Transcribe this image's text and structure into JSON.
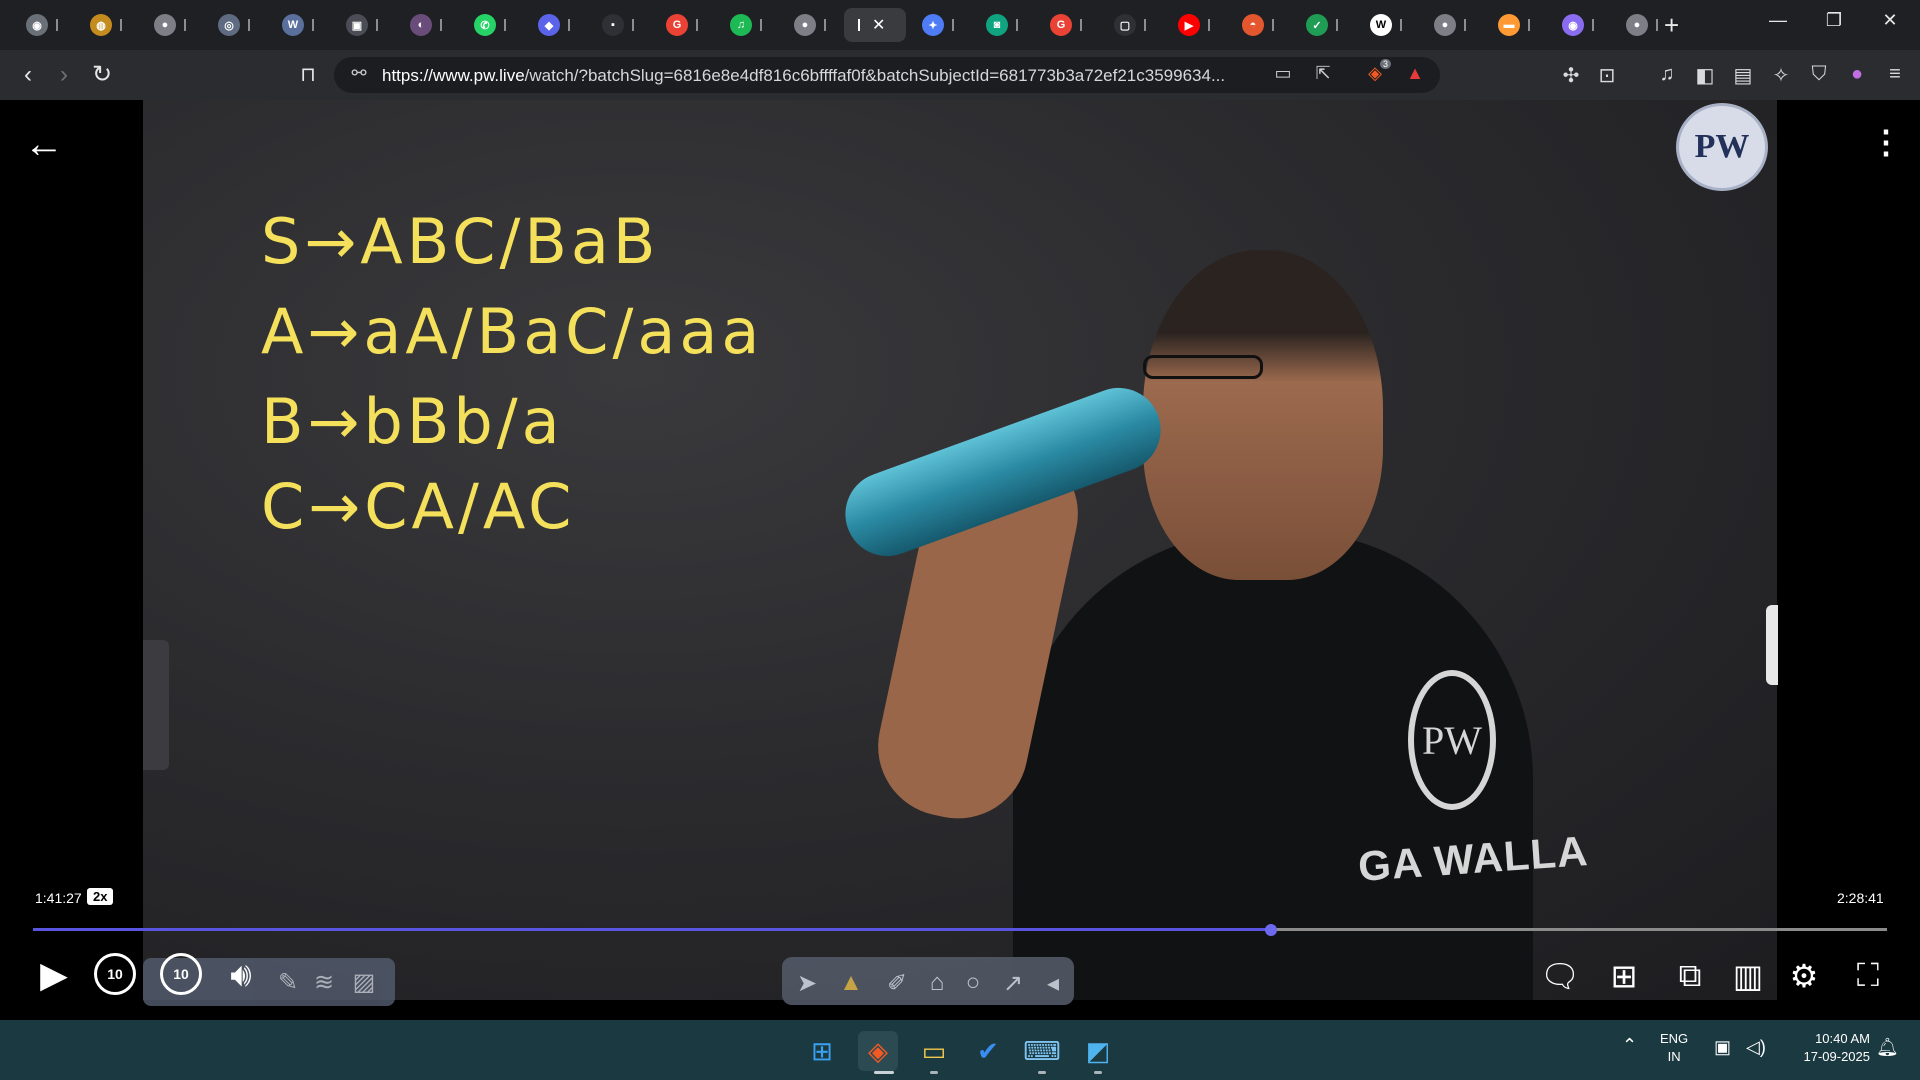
{
  "browser": {
    "tabs": [
      {
        "fav": "◉",
        "color": "#6a7078"
      },
      {
        "fav": "◍",
        "color": "#c48b1f"
      },
      {
        "fav": "●",
        "color": "#7c7f86"
      },
      {
        "fav": "◎",
        "color": "#5f6b80"
      },
      {
        "fav": "W",
        "color": "#5a6f9c"
      },
      {
        "fav": "▣",
        "color": "#4a4d55"
      },
      {
        "fav": "◐",
        "color": "#6a4c7a"
      },
      {
        "fav": "✆",
        "color": "#25d366"
      },
      {
        "fav": "◆",
        "color": "#5b63e8"
      },
      {
        "fav": "▪",
        "color": "#2f3035"
      },
      {
        "fav": "G",
        "color": "#ea4335"
      },
      {
        "fav": "♫",
        "color": "#1db954"
      },
      {
        "fav": "●",
        "color": "#7c7f86"
      },
      {
        "fav": "",
        "color": "#3a3b3f",
        "active": true
      },
      {
        "fav": "✦",
        "color": "#4e7cf5"
      },
      {
        "fav": "◙",
        "color": "#10a37f"
      },
      {
        "fav": "G",
        "color": "#ea4335"
      },
      {
        "fav": "▢",
        "color": "#2f3035"
      },
      {
        "fav": "▶",
        "color": "#ff0000"
      },
      {
        "fav": "◓",
        "color": "#e4572e"
      },
      {
        "fav": "✓",
        "color": "#1f9d55"
      },
      {
        "fav": "W",
        "color": "#ffffff"
      },
      {
        "fav": "●",
        "color": "#7c7f86"
      },
      {
        "fav": "▬",
        "color": "#ff9933"
      },
      {
        "fav": "◉",
        "color": "#8a6cf0"
      },
      {
        "fav": "●",
        "color": "#7c7f86"
      }
    ],
    "new_tab_icon": "+",
    "window_controls": {
      "minimize": "—",
      "restore": "❐",
      "close": "✕"
    },
    "url_host": "https://www.pw.live",
    "url_rest": "/watch/?batchSlug=6816e8e4df816c6bffffaf0f&batchSubjectId=681773b3a72ef21c3599634...",
    "brave_shield_count": "3"
  },
  "video": {
    "board_lines": [
      "S→ABC/BaB",
      "A→aA/BaC/aaa",
      "B→bBb/a",
      "C→CA/AC"
    ],
    "shirt_text": "GA WALLA",
    "shirt_logo": "PW",
    "watermark": "PW"
  },
  "player": {
    "current_time": "1:41:27",
    "speed": "2x",
    "total_time": "2:28:41",
    "progress_fraction": 0.668,
    "skip_back_label": "10",
    "skip_forward_label": "10"
  },
  "taskbar": {
    "lang_top": "ENG",
    "lang_bottom": "IN",
    "time": "10:40 AM",
    "date": "17-09-2025"
  }
}
